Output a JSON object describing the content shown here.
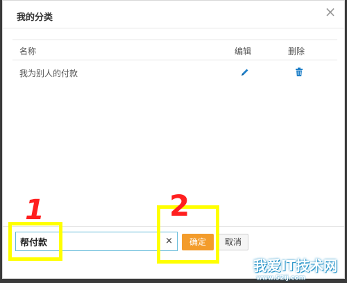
{
  "dialog": {
    "title": "我的分类",
    "close_icon": "×"
  },
  "table": {
    "headers": {
      "name": "名称",
      "edit": "编辑",
      "delete": "删除"
    },
    "rows": [
      {
        "name": "我为别人的付款"
      }
    ]
  },
  "form": {
    "input_value": "帮付款",
    "clear_label": "×",
    "confirm_label": "确定",
    "cancel_label": "取消"
  },
  "annotations": {
    "label_1": "1",
    "label_2": "2",
    "highlight_color": "#ffff00",
    "number_color": "#ff1f1f"
  },
  "colors": {
    "icon_blue": "#1e7fc8",
    "confirm_orange": "#f39c2b",
    "input_border": "#5fb9d8"
  },
  "watermark": {
    "text": "我爱IT技术网",
    "sub": "www.52ij.com"
  }
}
